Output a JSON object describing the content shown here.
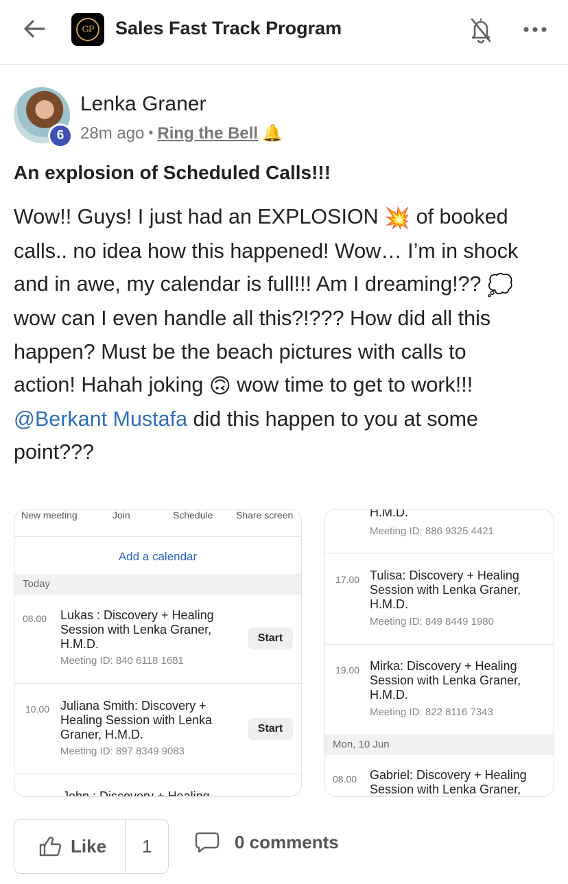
{
  "header": {
    "group_name": "Sales Fast Track Program",
    "logo_text": "GP",
    "icons": [
      "back-arrow-icon",
      "group-logo",
      "bell-off-icon",
      "more-icon"
    ]
  },
  "post": {
    "author": "Lenka Graner",
    "level": "6",
    "time": "28m ago",
    "separator": "•",
    "category": "Ring the Bell",
    "category_emoji": "🔔",
    "title": "An explosion of Scheduled Calls!!!",
    "body": {
      "l1a": "Wow!! Guys! I just had an EXPLOSION ",
      "l1emoji": "💥",
      "l1b": " of booked",
      "l2": "calls.. no idea how this happened! Wow… I’m in shock",
      "l3a": "and in awe, my calendar is full!!! Am I dreaming!?? ",
      "l3emoji": "💭",
      "l4": "wow can I even handle all this?!??? How did all this",
      "l5": "happen? Must be the beach pictures with calls to",
      "l6a": "action! Hahah joking ",
      "l6emoji": "🙃",
      "l6b": " wow time to get to work!!!",
      "mention": "@Berkant Mustafa",
      "l7b": " did this happen to you at some",
      "l8": "point???"
    }
  },
  "image1": {
    "tabs": [
      "New meeting",
      "Join",
      "Schedule",
      "Share screen"
    ],
    "add_calendar": "Add a calendar",
    "section": "Today",
    "meetings": [
      {
        "time": "08.00",
        "lines": [
          "Lukas : Discovery + Healing",
          "Session with Lenka Graner,",
          "H.M.D."
        ],
        "id": "Meeting ID: 840 6118 1681",
        "action": "Start"
      },
      {
        "time": "10.00",
        "lines": [
          "Juliana Smith: Discovery +",
          "Healing Session with Lenka",
          "Graner, H.M.D."
        ],
        "id": "Meeting ID: 897 8349 9083",
        "action": "Start"
      }
    ],
    "cut_text": "John : Discovery + Healing"
  },
  "image2": {
    "top_title": "H.M.D.",
    "top_id": "Meeting ID: 886 9325 4421",
    "meetings": [
      {
        "time": "17.00",
        "lines": [
          "Tulisa: Discovery + Healing",
          "Session with Lenka Graner,",
          "H.M.D."
        ],
        "id": "Meeting ID: 849 8449 1980"
      },
      {
        "time": "19.00",
        "lines": [
          "Mirka: Discovery + Healing",
          "Session with Lenka Graner,",
          "H.M.D."
        ],
        "id": "Meeting ID: 822 8116 7343"
      }
    ],
    "section": "Mon, 10 Jun",
    "last": {
      "time": "08.00",
      "lines": [
        "Gabriel: Discovery + Healing",
        "Session with Lenka Graner,"
      ]
    }
  },
  "footer": {
    "like_label": "Like",
    "like_count": "1",
    "comments_label": "0 comments"
  }
}
